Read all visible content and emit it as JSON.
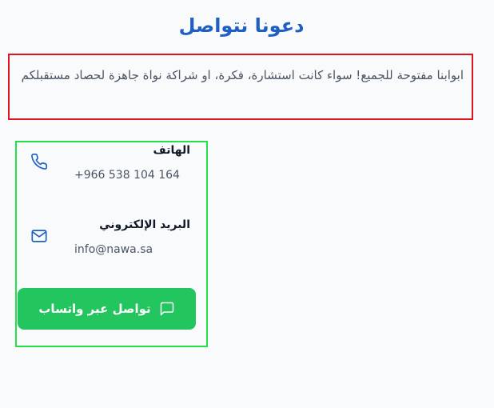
{
  "section": {
    "title": "دعونا نتواصل",
    "intro": "ابوابنا مفتوحة للجميع! سواء كانت استشارة، فكرة، او شراكة نواة جاهزة لحصاد مستقبلكم"
  },
  "contact": {
    "phone": {
      "label": "الهاتف",
      "value": "+966 538 104 164",
      "icon": "phone-icon"
    },
    "email": {
      "label": "البريد الإلكتروني",
      "value": "info@nawa.sa",
      "icon": "mail-icon"
    },
    "whatsapp_button": {
      "label": "تواصل عبر واتساب",
      "icon": "chat-icon"
    }
  },
  "colors": {
    "title": "#1f5fc4",
    "icon": "#1f5fc4",
    "whatsapp": "#22c55e",
    "intro_border": "#e0141e",
    "contact_border": "#22e04a",
    "background": "#f8fafc"
  }
}
